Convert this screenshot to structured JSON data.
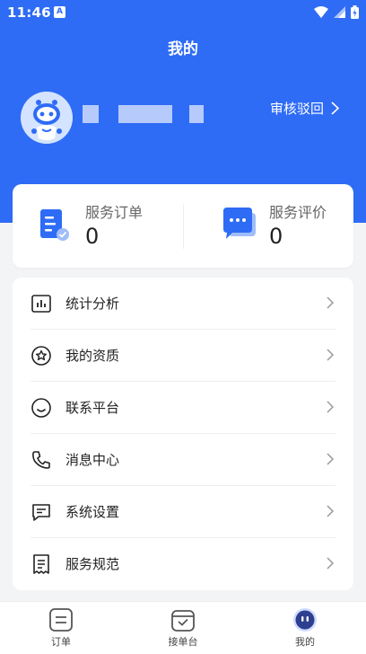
{
  "status_bar": {
    "time": "11:46",
    "app_badge": "A"
  },
  "header": {
    "title": "我的",
    "review_label": "审核驳回"
  },
  "stats": [
    {
      "label": "服务订单",
      "value": "0",
      "icon": "order-doc-icon"
    },
    {
      "label": "服务评价",
      "value": "0",
      "icon": "chat-bubble-icon"
    }
  ],
  "menu": {
    "items": [
      {
        "label": "统计分析",
        "icon": "bar-chart-icon"
      },
      {
        "label": "我的资质",
        "icon": "star-badge-icon"
      },
      {
        "label": "联系平台",
        "icon": "smile-icon"
      },
      {
        "label": "消息中心",
        "icon": "phone-icon"
      },
      {
        "label": "系统设置",
        "icon": "message-icon"
      },
      {
        "label": "服务规范",
        "icon": "receipt-icon"
      }
    ]
  },
  "tabs": [
    {
      "label": "订单",
      "icon": "order-tab-icon"
    },
    {
      "label": "接单台",
      "icon": "accept-tab-icon"
    },
    {
      "label": "我的",
      "icon": "mine-tab-icon"
    }
  ],
  "colors": {
    "primary": "#2e6cf6",
    "background": "#f3f4f6"
  }
}
